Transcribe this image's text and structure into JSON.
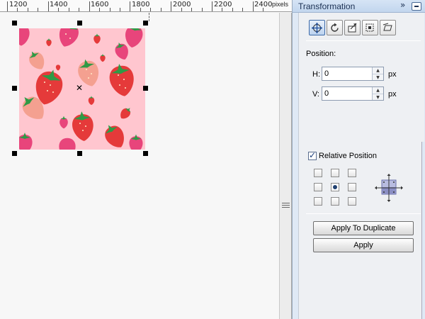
{
  "ruler": {
    "labels": [
      "1200",
      "1400",
      "1600",
      "1800",
      "2000",
      "2200",
      "2400"
    ],
    "units": "pixels"
  },
  "docker": {
    "title": "Transformation",
    "chevron": "»",
    "tools": [
      "position-icon",
      "rotate-icon",
      "scale-icon",
      "size-icon",
      "skew-icon"
    ],
    "position_label": "Position:",
    "h_label": "H:",
    "h_value": "0",
    "h_unit": "px",
    "v_label": "V:",
    "v_value": "0",
    "v_unit": "px",
    "relative_label": "Relative Position",
    "relative_checked": true,
    "apply_duplicate_label": "Apply To Duplicate",
    "apply_label": "Apply"
  },
  "colors": {
    "artwork_bg": "#ffc6cf",
    "strawberry_red": "#e53a3a",
    "strawberry_pink": "#e8457b",
    "strawberry_light": "#f4a090",
    "leaf": "#2f9a46"
  }
}
